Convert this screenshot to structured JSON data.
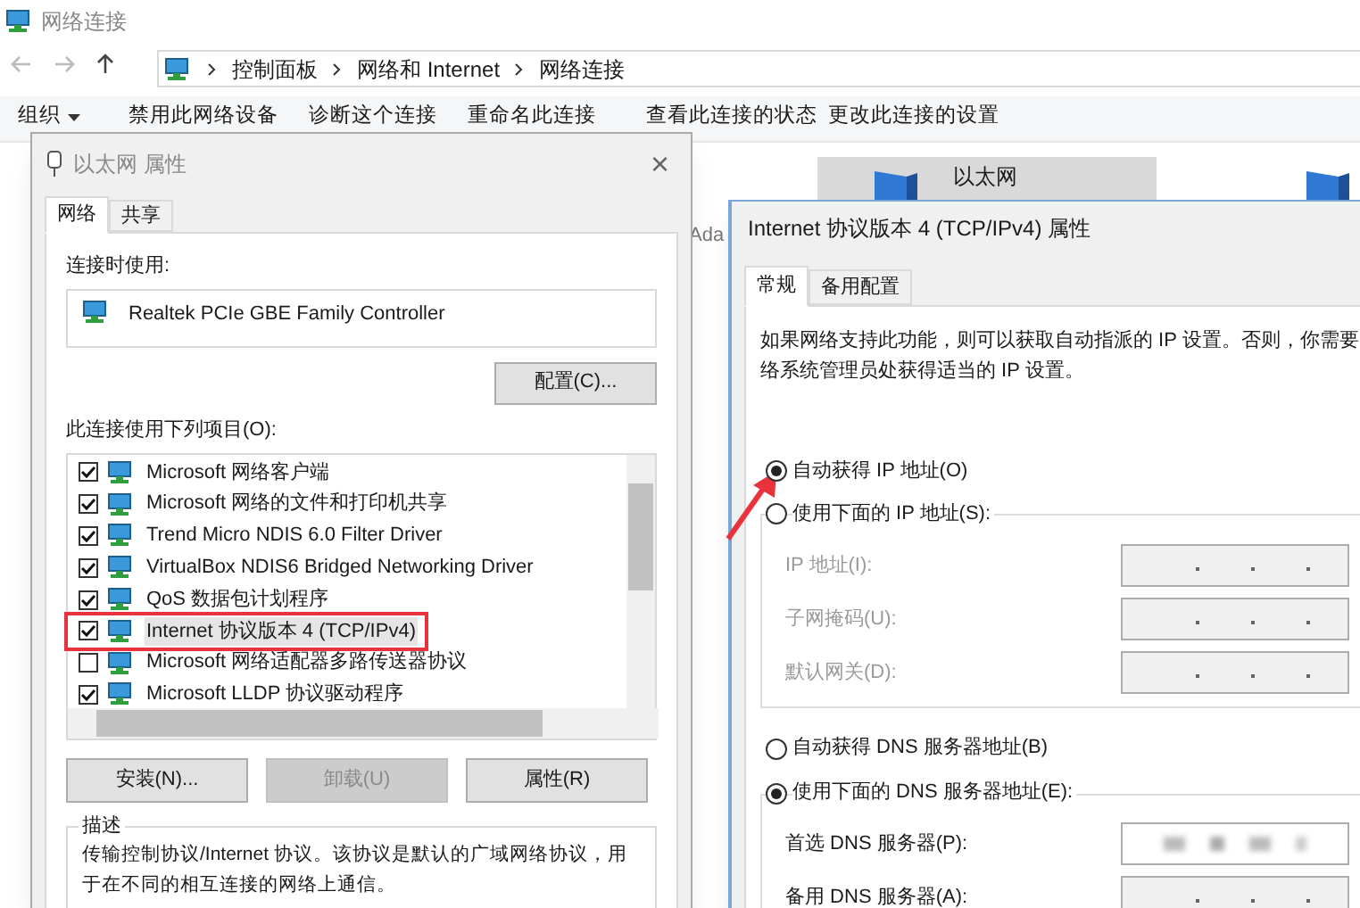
{
  "window": {
    "title": "网络连接"
  },
  "address_bar": {
    "breadcrumbs": [
      "控制面板",
      "网络和 Internet",
      "网络连接"
    ]
  },
  "toolbar": [
    {
      "label": "组织",
      "dropdown": true
    },
    {
      "label": "禁用此网络设备",
      "dropdown": false
    },
    {
      "label": "诊断这个连接",
      "dropdown": false
    },
    {
      "label": "重命名此连接",
      "dropdown": false
    },
    {
      "label": "查看此连接的状态",
      "dropdown": false
    },
    {
      "label": "更改此连接的设置",
      "dropdown": false
    }
  ],
  "connections": [
    {
      "name": "以太网",
      "selected": true
    },
    {
      "selected": false
    }
  ],
  "background_text": "Ada",
  "ethernet_dialog": {
    "title": "以太网 属性",
    "close": "×",
    "tabs": [
      {
        "label": "网络",
        "selected": true
      },
      {
        "label": "共享",
        "selected": false
      }
    ],
    "connect_using_label": "连接时使用:",
    "adapter": "Realtek PCIe GBE Family Controller",
    "configure_button": "配置(C)...",
    "items_label": "此连接使用下列项目(O):",
    "items": [
      {
        "label": "Microsoft 网络客户端",
        "checked": true,
        "selected": false,
        "annotated": false
      },
      {
        "label": "Microsoft 网络的文件和打印机共享",
        "checked": true,
        "selected": false,
        "annotated": false
      },
      {
        "label": "Trend Micro NDIS 6.0 Filter Driver",
        "checked": true,
        "selected": false,
        "annotated": false
      },
      {
        "label": "VirtualBox NDIS6 Bridged Networking Driver",
        "checked": true,
        "selected": false,
        "annotated": false
      },
      {
        "label": "QoS 数据包计划程序",
        "checked": true,
        "selected": false,
        "annotated": false
      },
      {
        "label": "Internet 协议版本 4 (TCP/IPv4)",
        "checked": true,
        "selected": true,
        "annotated": true
      },
      {
        "label": "Microsoft 网络适配器多路传送器协议",
        "checked": false,
        "selected": false,
        "annotated": false
      },
      {
        "label": "Microsoft LLDP 协议驱动程序",
        "checked": true,
        "selected": false,
        "annotated": false
      }
    ],
    "buttons": [
      {
        "label": "安装(N)...",
        "disabled": false
      },
      {
        "label": "卸载(U)",
        "disabled": true
      },
      {
        "label": "属性(R)",
        "disabled": false
      }
    ],
    "description_title": "描述",
    "description": [
      "传输控制协议/Internet 协议。该协议是默认的广域网络协议，用",
      "于在不同的相互连接的网络上通信。"
    ]
  },
  "ipv4_dialog": {
    "title": "Internet 协议版本 4 (TCP/IPv4) 属性",
    "tabs": [
      {
        "label": "常规",
        "selected": true
      },
      {
        "label": "备用配置",
        "selected": false
      }
    ],
    "intro": [
      "如果网络支持此功能，则可以获取自动指派的 IP 设置。否则，你需要",
      "络系统管理员处获得适当的 IP 设置。"
    ],
    "ip_mode": [
      {
        "label": "自动获得 IP 地址(O)",
        "selected": true
      },
      {
        "label": "使用下面的 IP 地址(S):",
        "selected": false
      }
    ],
    "ip_fields": [
      {
        "label": "IP 地址(I):",
        "disabled": true
      },
      {
        "label": "子网掩码(U):",
        "disabled": true
      },
      {
        "label": "默认网关(D):",
        "disabled": true
      }
    ],
    "dns_mode": [
      {
        "label": "自动获得 DNS 服务器地址(B)",
        "selected": false
      },
      {
        "label": "使用下面的 DNS 服务器地址(E):",
        "selected": true
      }
    ],
    "dns_fields": [
      {
        "label": "首选 DNS 服务器(P):",
        "blurred": true
      },
      {
        "label": "备用 DNS 服务器(A):",
        "blurred": false
      }
    ]
  }
}
